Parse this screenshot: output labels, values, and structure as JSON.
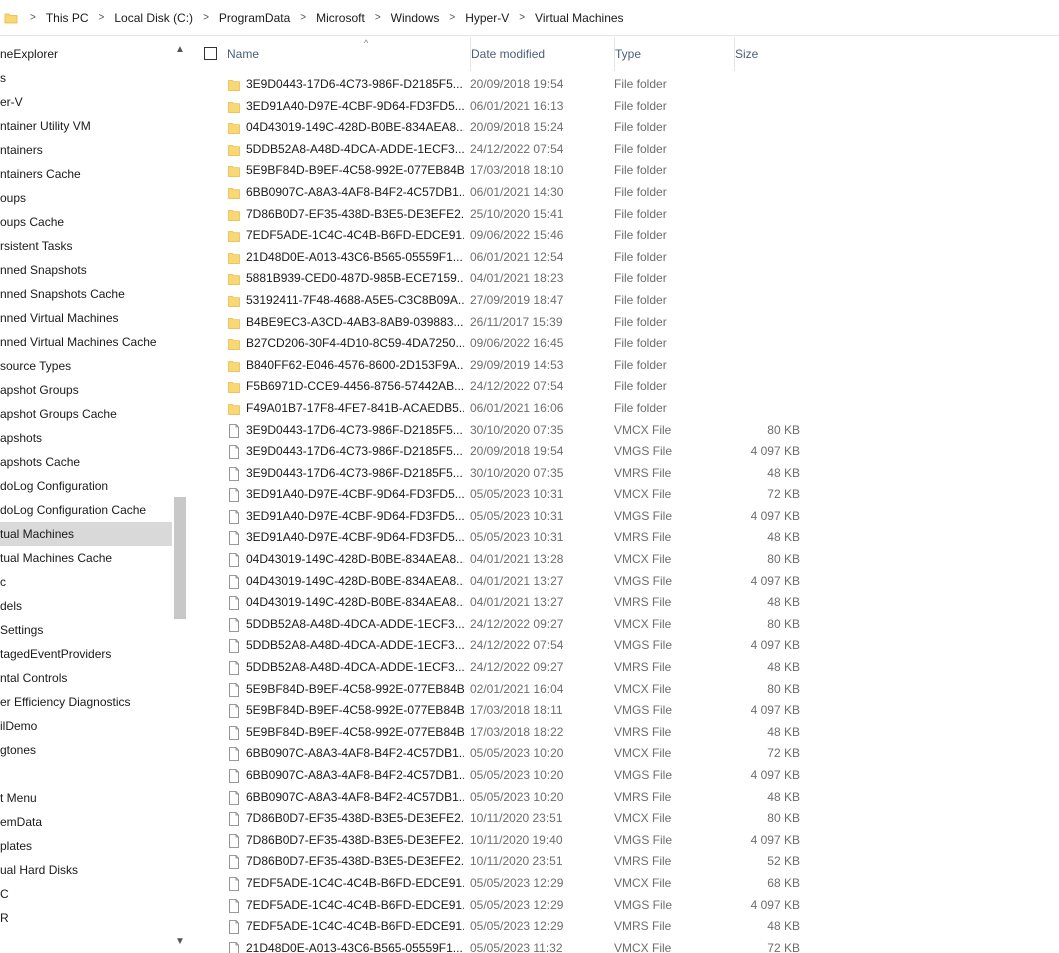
{
  "address": {
    "crumbs": [
      "This PC",
      "Local Disk (C:)",
      "ProgramData",
      "Microsoft",
      "Windows",
      "Hyper-V",
      "Virtual Machines"
    ]
  },
  "nav": {
    "items": [
      "neExplorer",
      "s",
      "er-V",
      "ntainer Utility VM",
      "ntainers",
      "ntainers Cache",
      "oups",
      "oups Cache",
      "rsistent Tasks",
      "nned Snapshots",
      "nned Snapshots Cache",
      "nned Virtual Machines",
      "nned Virtual Machines Cache",
      "source Types",
      "apshot Groups",
      "apshot Groups Cache",
      "apshots",
      "apshots Cache",
      "doLog Configuration",
      "doLog Configuration Cache",
      "tual Machines",
      "tual Machines Cache",
      "c",
      "dels",
      "Settings",
      "tagedEventProviders",
      "ntal Controls",
      "er Efficiency Diagnostics",
      "ilDemo",
      "gtones",
      "",
      "t Menu",
      "emData",
      "plates",
      "ual Hard Disks",
      "C",
      "R"
    ],
    "selected_index": 20
  },
  "columns": {
    "name": "Name",
    "date": "Date modified",
    "type": "Type",
    "size": "Size"
  },
  "files": [
    {
      "icon": "folder-icon",
      "name": "3E9D0443-17D6-4C73-986F-D2185F5...",
      "date": "20/09/2018 19:54",
      "type": "File folder",
      "size": ""
    },
    {
      "icon": "folder-icon",
      "name": "3ED91A40-D97E-4CBF-9D64-FD3FD5...",
      "date": "06/01/2021 16:13",
      "type": "File folder",
      "size": ""
    },
    {
      "icon": "folder-icon",
      "name": "04D43019-149C-428D-B0BE-834AEA8...",
      "date": "20/09/2018 15:24",
      "type": "File folder",
      "size": ""
    },
    {
      "icon": "folder-icon",
      "name": "5DDB52A8-A48D-4DCA-ADDE-1ECF3...",
      "date": "24/12/2022 07:54",
      "type": "File folder",
      "size": ""
    },
    {
      "icon": "folder-icon",
      "name": "5E9BF84D-B9EF-4C58-992E-077EB84B...",
      "date": "17/03/2018 18:10",
      "type": "File folder",
      "size": ""
    },
    {
      "icon": "folder-icon",
      "name": "6BB0907C-A8A3-4AF8-B4F2-4C57DB1...",
      "date": "06/01/2021 14:30",
      "type": "File folder",
      "size": ""
    },
    {
      "icon": "folder-icon",
      "name": "7D86B0D7-EF35-438D-B3E5-DE3EFE2...",
      "date": "25/10/2020 15:41",
      "type": "File folder",
      "size": ""
    },
    {
      "icon": "folder-icon",
      "name": "7EDF5ADE-1C4C-4C4B-B6FD-EDCE91...",
      "date": "09/06/2022 15:46",
      "type": "File folder",
      "size": ""
    },
    {
      "icon": "folder-icon",
      "name": "21D48D0E-A013-43C6-B565-05559F1...",
      "date": "06/01/2021 12:54",
      "type": "File folder",
      "size": ""
    },
    {
      "icon": "folder-icon",
      "name": "5881B939-CED0-487D-985B-ECE7159...",
      "date": "04/01/2021 18:23",
      "type": "File folder",
      "size": ""
    },
    {
      "icon": "folder-icon",
      "name": "53192411-7F48-4688-A5E5-C3C8B09A...",
      "date": "27/09/2019 18:47",
      "type": "File folder",
      "size": ""
    },
    {
      "icon": "folder-icon",
      "name": "B4BE9EC3-A3CD-4AB3-8AB9-039883...",
      "date": "26/11/2017 15:39",
      "type": "File folder",
      "size": ""
    },
    {
      "icon": "folder-icon",
      "name": "B27CD206-30F4-4D10-8C59-4DA7250...",
      "date": "09/06/2022 16:45",
      "type": "File folder",
      "size": ""
    },
    {
      "icon": "folder-icon",
      "name": "B840FF62-E046-4576-8600-2D153F9A...",
      "date": "29/09/2019 14:53",
      "type": "File folder",
      "size": ""
    },
    {
      "icon": "folder-icon",
      "name": "F5B6971D-CCE9-4456-8756-57442AB...",
      "date": "24/12/2022 07:54",
      "type": "File folder",
      "size": ""
    },
    {
      "icon": "folder-icon",
      "name": "F49A01B7-17F8-4FE7-841B-ACAEDB5...",
      "date": "06/01/2021 16:06",
      "type": "File folder",
      "size": ""
    },
    {
      "icon": "file-icon",
      "name": "3E9D0443-17D6-4C73-986F-D2185F5...",
      "date": "30/10/2020 07:35",
      "type": "VMCX File",
      "size": "80 KB"
    },
    {
      "icon": "file-icon",
      "name": "3E9D0443-17D6-4C73-986F-D2185F5...",
      "date": "20/09/2018 19:54",
      "type": "VMGS File",
      "size": "4 097 KB"
    },
    {
      "icon": "file-icon",
      "name": "3E9D0443-17D6-4C73-986F-D2185F5...",
      "date": "30/10/2020 07:35",
      "type": "VMRS File",
      "size": "48 KB"
    },
    {
      "icon": "file-icon",
      "name": "3ED91A40-D97E-4CBF-9D64-FD3FD5...",
      "date": "05/05/2023 10:31",
      "type": "VMCX File",
      "size": "72 KB"
    },
    {
      "icon": "file-icon",
      "name": "3ED91A40-D97E-4CBF-9D64-FD3FD5...",
      "date": "05/05/2023 10:31",
      "type": "VMGS File",
      "size": "4 097 KB"
    },
    {
      "icon": "file-icon",
      "name": "3ED91A40-D97E-4CBF-9D64-FD3FD5...",
      "date": "05/05/2023 10:31",
      "type": "VMRS File",
      "size": "48 KB"
    },
    {
      "icon": "file-icon",
      "name": "04D43019-149C-428D-B0BE-834AEA8...",
      "date": "04/01/2021 13:28",
      "type": "VMCX File",
      "size": "80 KB"
    },
    {
      "icon": "file-icon",
      "name": "04D43019-149C-428D-B0BE-834AEA8...",
      "date": "04/01/2021 13:27",
      "type": "VMGS File",
      "size": "4 097 KB"
    },
    {
      "icon": "file-icon",
      "name": "04D43019-149C-428D-B0BE-834AEA8...",
      "date": "04/01/2021 13:27",
      "type": "VMRS File",
      "size": "48 KB"
    },
    {
      "icon": "file-icon",
      "name": "5DDB52A8-A48D-4DCA-ADDE-1ECF3...",
      "date": "24/12/2022 09:27",
      "type": "VMCX File",
      "size": "80 KB"
    },
    {
      "icon": "file-icon",
      "name": "5DDB52A8-A48D-4DCA-ADDE-1ECF3...",
      "date": "24/12/2022 07:54",
      "type": "VMGS File",
      "size": "4 097 KB"
    },
    {
      "icon": "file-icon",
      "name": "5DDB52A8-A48D-4DCA-ADDE-1ECF3...",
      "date": "24/12/2022 09:27",
      "type": "VMRS File",
      "size": "48 KB"
    },
    {
      "icon": "file-icon",
      "name": "5E9BF84D-B9EF-4C58-992E-077EB84B...",
      "date": "02/01/2021 16:04",
      "type": "VMCX File",
      "size": "80 KB"
    },
    {
      "icon": "file-icon",
      "name": "5E9BF84D-B9EF-4C58-992E-077EB84B...",
      "date": "17/03/2018 18:11",
      "type": "VMGS File",
      "size": "4 097 KB"
    },
    {
      "icon": "file-icon",
      "name": "5E9BF84D-B9EF-4C58-992E-077EB84B...",
      "date": "17/03/2018 18:22",
      "type": "VMRS File",
      "size": "48 KB"
    },
    {
      "icon": "file-icon",
      "name": "6BB0907C-A8A3-4AF8-B4F2-4C57DB1...",
      "date": "05/05/2023 10:20",
      "type": "VMCX File",
      "size": "72 KB"
    },
    {
      "icon": "file-icon",
      "name": "6BB0907C-A8A3-4AF8-B4F2-4C57DB1...",
      "date": "05/05/2023 10:20",
      "type": "VMGS File",
      "size": "4 097 KB"
    },
    {
      "icon": "file-icon",
      "name": "6BB0907C-A8A3-4AF8-B4F2-4C57DB1...",
      "date": "05/05/2023 10:20",
      "type": "VMRS File",
      "size": "48 KB"
    },
    {
      "icon": "file-icon",
      "name": "7D86B0D7-EF35-438D-B3E5-DE3EFE2...",
      "date": "10/11/2020 23:51",
      "type": "VMCX File",
      "size": "80 KB"
    },
    {
      "icon": "file-icon",
      "name": "7D86B0D7-EF35-438D-B3E5-DE3EFE2...",
      "date": "10/11/2020 19:40",
      "type": "VMGS File",
      "size": "4 097 KB"
    },
    {
      "icon": "file-icon",
      "name": "7D86B0D7-EF35-438D-B3E5-DE3EFE2...",
      "date": "10/11/2020 23:51",
      "type": "VMRS File",
      "size": "52 KB"
    },
    {
      "icon": "file-icon",
      "name": "7EDF5ADE-1C4C-4C4B-B6FD-EDCE91...",
      "date": "05/05/2023 12:29",
      "type": "VMCX File",
      "size": "68 KB"
    },
    {
      "icon": "file-icon",
      "name": "7EDF5ADE-1C4C-4C4B-B6FD-EDCE91...",
      "date": "05/05/2023 12:29",
      "type": "VMGS File",
      "size": "4 097 KB"
    },
    {
      "icon": "file-icon",
      "name": "7EDF5ADE-1C4C-4C4B-B6FD-EDCE91...",
      "date": "05/05/2023 12:29",
      "type": "VMRS File",
      "size": "48 KB"
    },
    {
      "icon": "file-icon",
      "name": "21D48D0E-A013-43C6-B565-05559F1...",
      "date": "05/05/2023 11:32",
      "type": "VMCX File",
      "size": "72 KB"
    }
  ],
  "colors": {
    "folder": "#f8d775",
    "folder_dark": "#e8b73f",
    "selected_nav": "#d9d9d9",
    "header_text": "#4c607a",
    "muted_text": "#6d6d6d"
  }
}
